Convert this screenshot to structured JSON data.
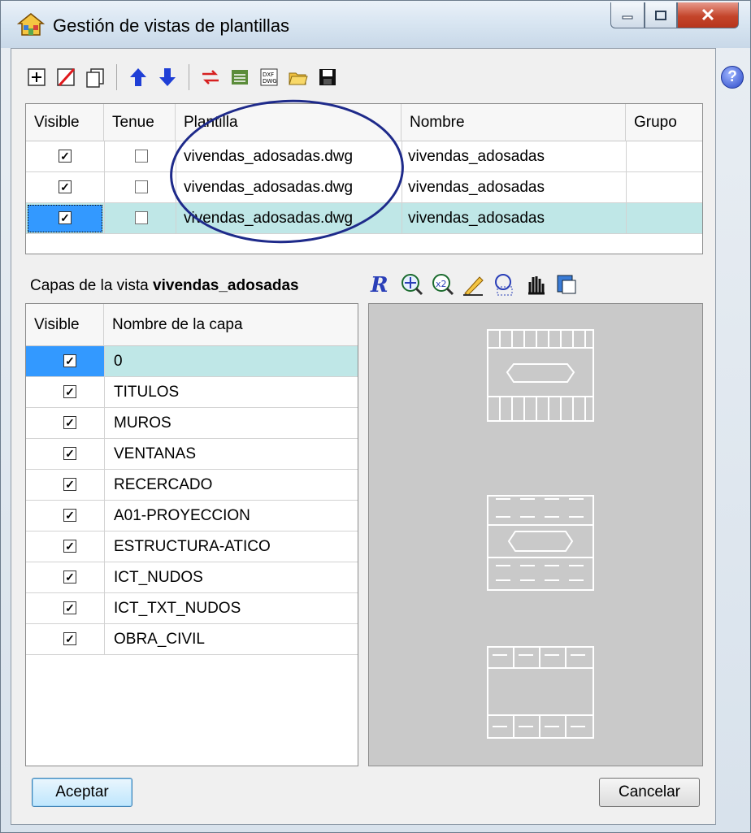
{
  "window": {
    "title": "Gestión de vistas de plantillas",
    "help": "?"
  },
  "toolbar": {
    "icons": [
      "add-icon",
      "delete-icon",
      "copy-icon",
      "move-up-icon",
      "move-down-icon",
      "swap-icon",
      "validate-icon",
      "dxf-dwg-icon",
      "open-folder-icon",
      "save-icon"
    ]
  },
  "templates": {
    "headers": {
      "visible": "Visible",
      "tenue": "Tenue",
      "plantilla": "Plantilla",
      "nombre": "Nombre",
      "grupo": "Grupo"
    },
    "rows": [
      {
        "visible": "✓",
        "tenue": "",
        "plantilla": "vivendas_adosadas.dwg",
        "nombre": "vivendas_adosadas",
        "grupo": ""
      },
      {
        "visible": "✓",
        "tenue": "",
        "plantilla": "vivendas_adosadas.dwg",
        "nombre": "vivendas_adosadas",
        "grupo": ""
      },
      {
        "visible": "✓",
        "tenue": "",
        "plantilla": "vivendas_adosadas.dwg",
        "nombre": "vivendas_adosadas",
        "grupo": ""
      }
    ]
  },
  "layers": {
    "label": "Capas de la vista",
    "view_name": "vivendas_adosadas",
    "headers": {
      "visible": "Visible",
      "name": "Nombre de la capa"
    },
    "rows": [
      {
        "visible": "✓",
        "name": "0"
      },
      {
        "visible": "✓",
        "name": "TITULOS"
      },
      {
        "visible": "✓",
        "name": "MUROS"
      },
      {
        "visible": "✓",
        "name": "VENTANAS"
      },
      {
        "visible": "✓",
        "name": "RECERCADO"
      },
      {
        "visible": "✓",
        "name": "A01-PROYECCION"
      },
      {
        "visible": "✓",
        "name": "ESTRUCTURA-ATICO"
      },
      {
        "visible": "✓",
        "name": "ICT_NUDOS"
      },
      {
        "visible": "✓",
        "name": "ICT_TXT_NUDOS"
      },
      {
        "visible": "✓",
        "name": "OBRA_CIVIL"
      }
    ],
    "tool_icons": [
      "zoom-realtime-icon",
      "zoom-extents-icon",
      "zoom-x2-icon",
      "draw-icon",
      "zoom-window-icon",
      "pan-hand-icon",
      "refresh-icon"
    ]
  },
  "buttons": {
    "accept": "Aceptar",
    "cancel": "Cancelar"
  },
  "colors": {
    "selection": "#bfe7e7",
    "focus": "#3399ff",
    "preview_bg": "#c9c9c9",
    "annotation": "#1e2a8a"
  }
}
